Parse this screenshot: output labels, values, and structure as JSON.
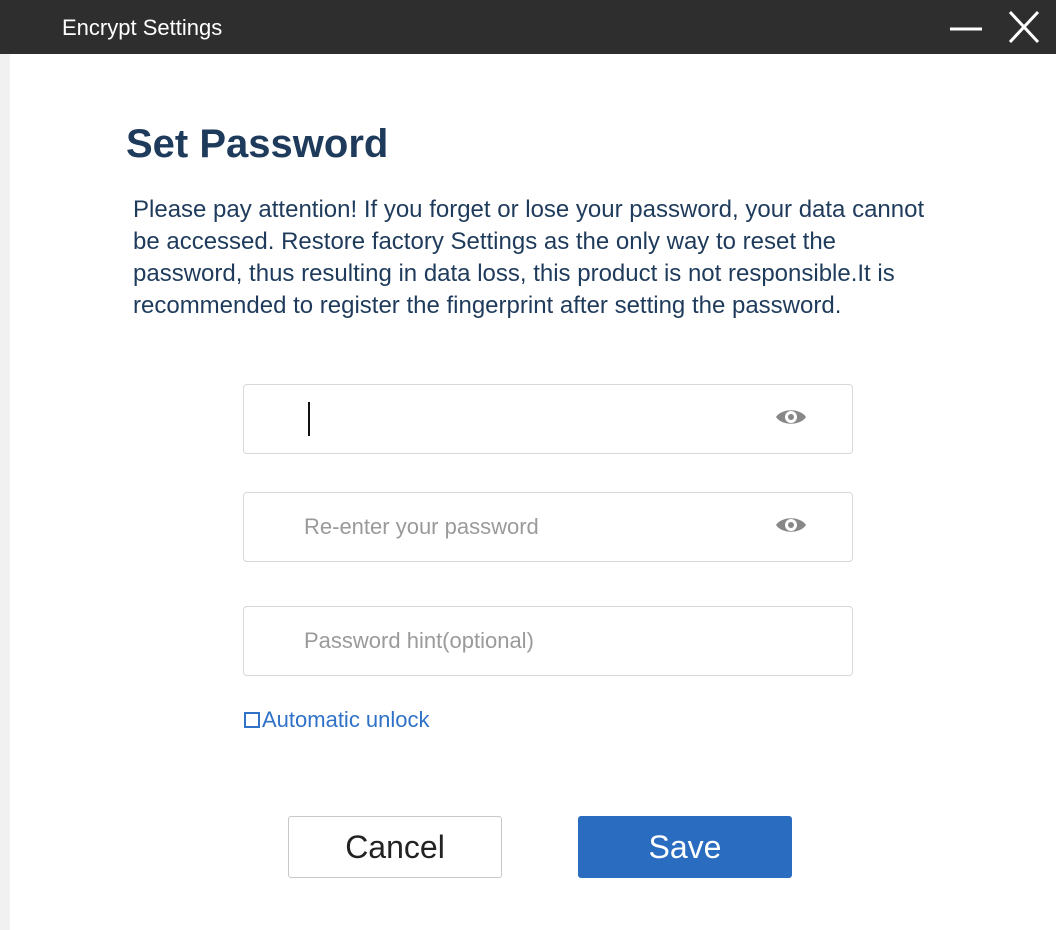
{
  "window": {
    "title": "Encrypt Settings",
    "minimize_icon": "minimize-icon",
    "close_icon": "close-icon"
  },
  "content": {
    "heading": "Set Password",
    "notice": "Please pay attention! If you forget or lose your password, your data cannot be accessed. Restore factory Settings as the only way to reset the password, thus resulting in data loss, this product is not responsible.It is recommended to register the fingerprint after setting the password."
  },
  "form": {
    "password": {
      "value": "",
      "placeholder": "",
      "toggle_icon": "eye-icon"
    },
    "confirm_password": {
      "value": "",
      "placeholder": "Re-enter your password",
      "toggle_icon": "eye-icon"
    },
    "hint": {
      "value": "",
      "placeholder": "Password hint(optional)"
    },
    "auto_unlock": {
      "label": "Automatic unlock",
      "checked": false
    }
  },
  "buttons": {
    "cancel": "Cancel",
    "save": "Save"
  },
  "colors": {
    "titlebar": "#2e2e2e",
    "heading": "#1f3b5c",
    "accent": "#2a6cc0",
    "link": "#2f72c8"
  }
}
